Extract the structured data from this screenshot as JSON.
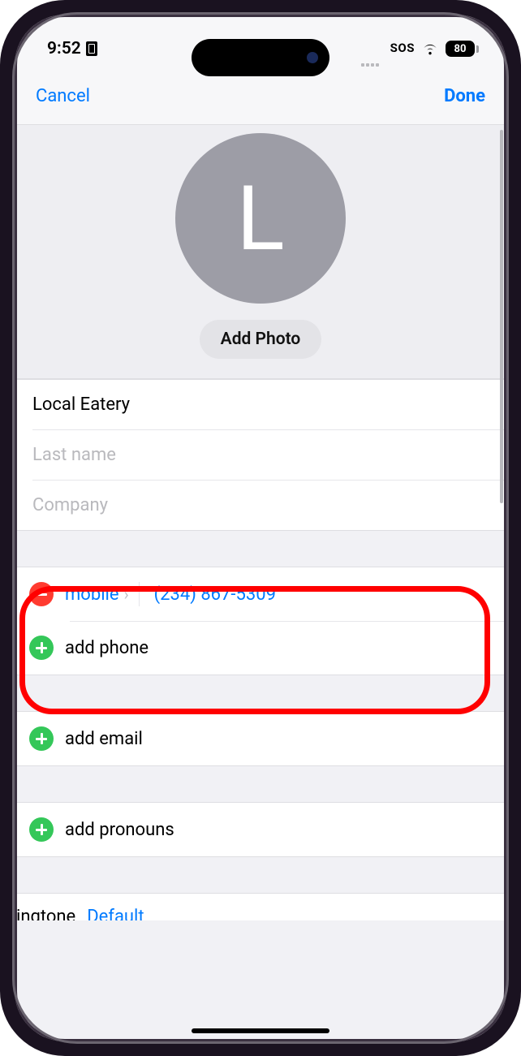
{
  "status": {
    "time": "9:52",
    "sos": "SOS",
    "battery": "80"
  },
  "nav": {
    "cancel": "Cancel",
    "done": "Done"
  },
  "avatar": {
    "initial": "L",
    "add_photo": "Add Photo"
  },
  "name_fields": {
    "first_value": "Local Eatery",
    "last_placeholder": "Last name",
    "company_placeholder": "Company"
  },
  "phone": {
    "label": "mobile",
    "number": "(234) 867-5309",
    "add_phone": "add phone"
  },
  "email": {
    "add_email": "add email"
  },
  "pronouns": {
    "add_pronouns": "add pronouns"
  },
  "ringtone": {
    "label": "Ringtone",
    "value": "Default"
  }
}
